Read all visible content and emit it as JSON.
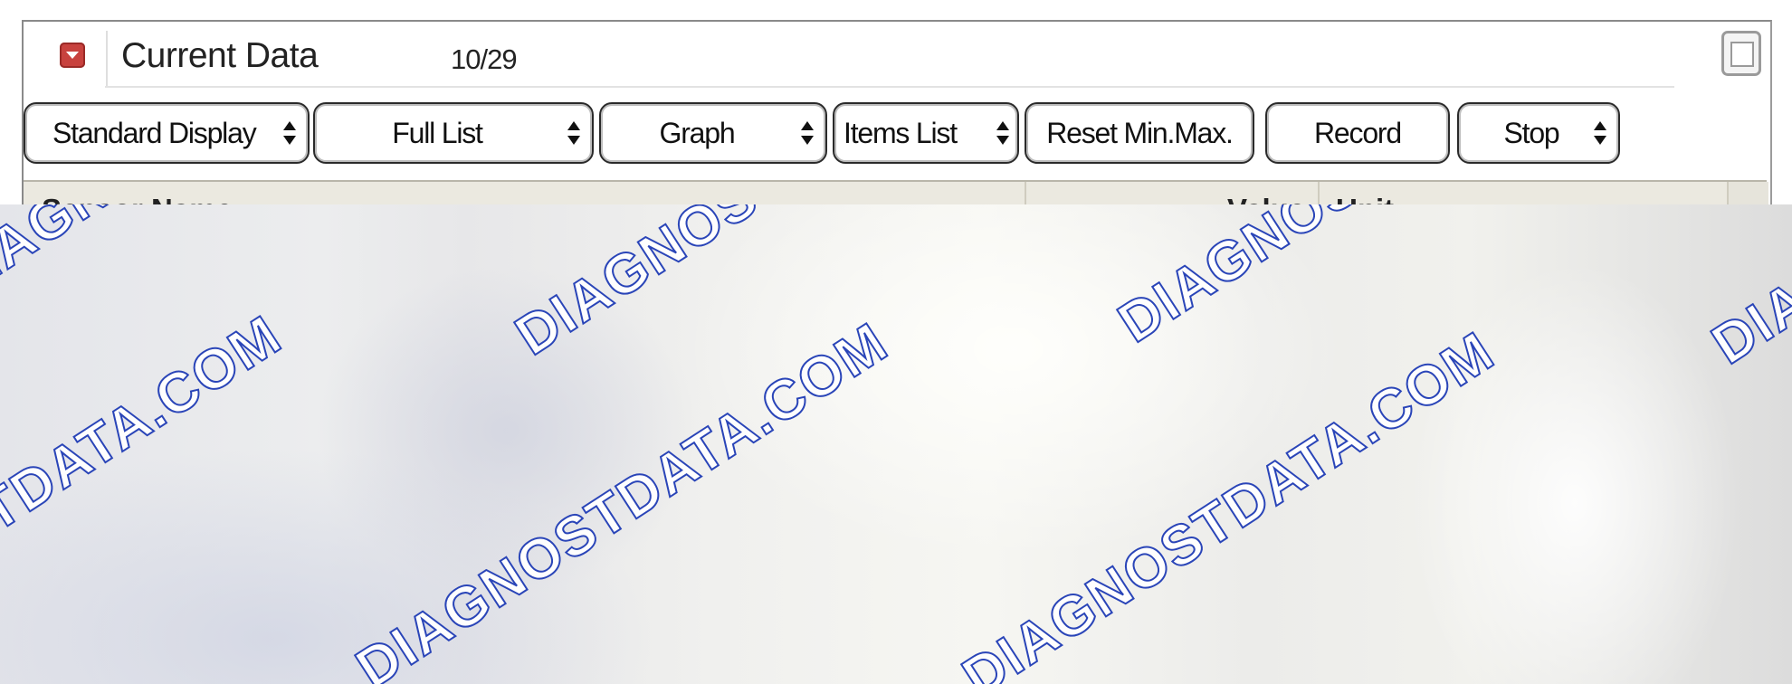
{
  "panel": {
    "title": "Current Data",
    "count": "10/29",
    "collapse_icon": "collapse-icon",
    "maximize_icon": "maximize-icon"
  },
  "toolbar": {
    "display_select": "Standard Display",
    "list_select": "Full List",
    "graph_select": "Graph",
    "items_list_select": "Items List",
    "reset_label": "Reset Min.Max.",
    "record_label": "Record",
    "stop_select": "Stop"
  },
  "table": {
    "columns": [
      "Sensor Name",
      "Value",
      "Unit"
    ]
  },
  "watermark": {
    "top_text": "DIAGNOSTDATA",
    "bottom_text": "DIAGNOSTDATA.COM",
    "color": "#2a45b8"
  }
}
